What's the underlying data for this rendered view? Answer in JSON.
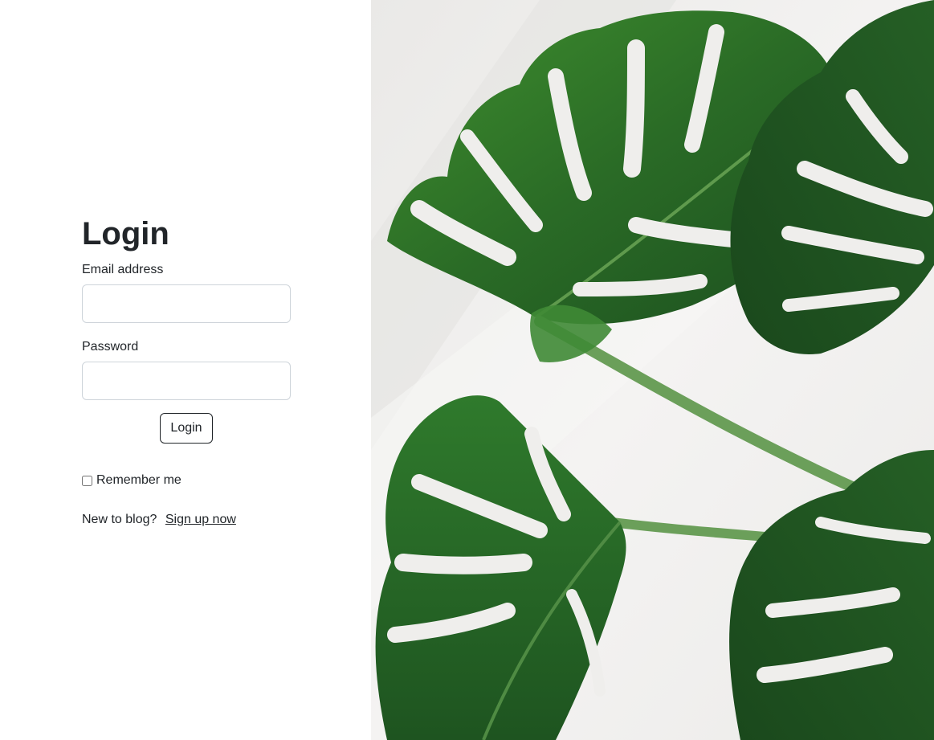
{
  "login": {
    "title": "Login",
    "email_label": "Email address",
    "email_value": "",
    "password_label": "Password",
    "password_value": "",
    "submit_label": "Login",
    "remember_label": "Remember me",
    "remember_checked": false,
    "signup_prompt": "New to blog?",
    "signup_link": "Sign up now"
  },
  "image": {
    "subject": "monstera leaves photo",
    "colors": {
      "background": "#efeeec",
      "leaf_dark": "#1f5a22",
      "leaf_mid": "#2e7d32",
      "leaf_light": "#4a9a3c",
      "stem": "#6b9f5a"
    }
  }
}
